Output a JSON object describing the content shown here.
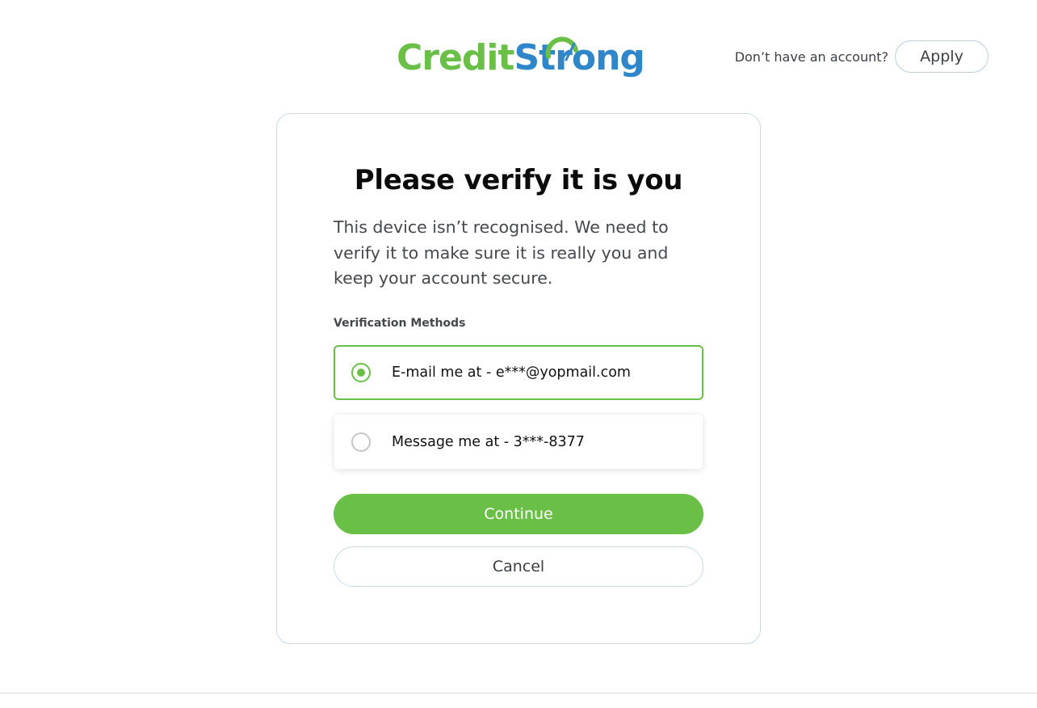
{
  "header": {
    "logo": {
      "part1": "Credit",
      "part2": "Strong",
      "color_credit": "#6abf47",
      "color_strong": "#2f86c8"
    },
    "account_prompt": "Don’t have an account?",
    "apply_label": "Apply"
  },
  "card": {
    "title": "Please verify it is you",
    "description": "This device isn’t recognised. We need to verify it to make sure it is really you and keep your account secure.",
    "methods_label": "Verification Methods",
    "methods": [
      {
        "label": "E-mail me at - e***@yopmail.com",
        "selected": true
      },
      {
        "label": "Message me at - 3***-8377",
        "selected": false
      }
    ],
    "continue_label": "Continue",
    "cancel_label": "Cancel"
  },
  "colors": {
    "accent_green": "#6abf47",
    "brand_blue": "#2f86c8",
    "border": "#c9dae5"
  }
}
